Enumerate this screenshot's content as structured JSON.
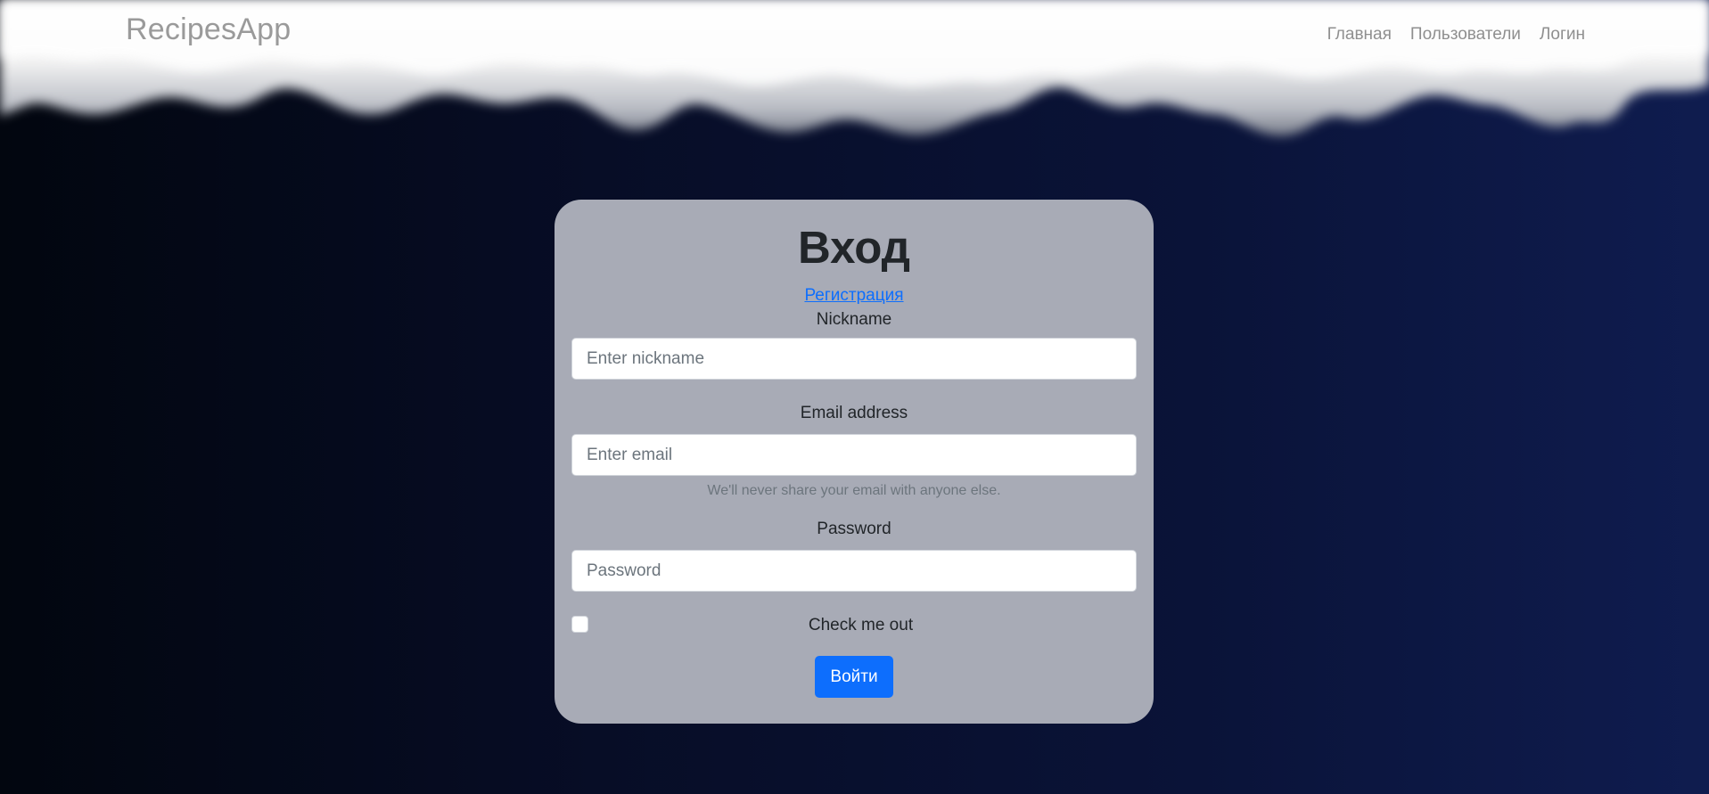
{
  "navbar": {
    "brand": "RecipesApp",
    "links": [
      "Главная",
      "Пользователи",
      "Логин"
    ]
  },
  "login": {
    "title": "Вход",
    "register_link": "Регистрация",
    "nickname_label": "Nickname",
    "nickname_placeholder": "Enter nickname",
    "email_label": "Email address",
    "email_placeholder": "Enter email",
    "email_help": "We'll never share your email with anyone else.",
    "password_label": "Password",
    "password_placeholder": "Password",
    "remember_label": "Check me out",
    "remember_checked": false,
    "submit_label": "Войти"
  },
  "colors": {
    "accent": "#0d6efd",
    "card_bg": "#a8abb6",
    "page_bg_dark": "#02060f",
    "page_bg_light": "#0f1c4f"
  }
}
